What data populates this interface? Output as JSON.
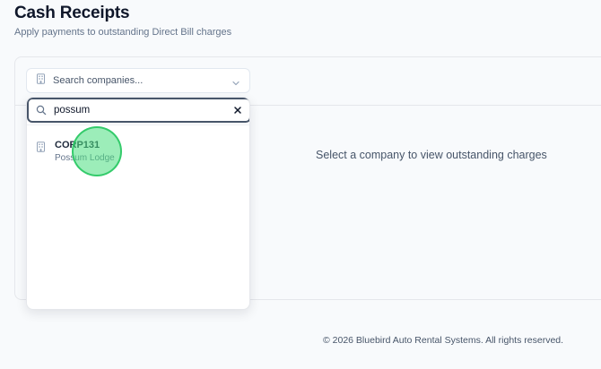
{
  "header": {
    "title": "Cash Receipts",
    "subtitle": "Apply payments to outstanding Direct Bill charges"
  },
  "company_select": {
    "placeholder": "Search companies...",
    "icon": "building-icon"
  },
  "dropdown": {
    "search_value": "possum",
    "options": [
      {
        "code": "CORP131",
        "name": "Possum Lodge"
      }
    ]
  },
  "main": {
    "empty_message": "Select a company to view outstanding charges"
  },
  "footer": {
    "copyright": "© 2026 Bluebird Auto Rental Systems. All rights reserved."
  },
  "colors": {
    "background": "#f8fafc",
    "focus_border": "#475569",
    "click_marker": "#4ade80"
  }
}
